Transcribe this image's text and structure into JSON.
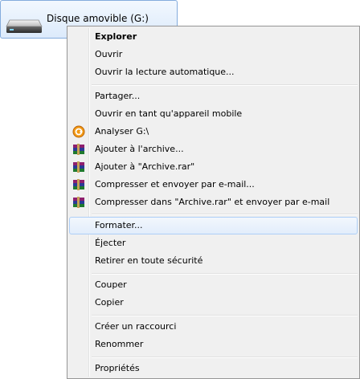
{
  "drive": {
    "label": "Disque amovible (G:)",
    "icon": "usb-drive-icon"
  },
  "menu": {
    "explorer": "Explorer",
    "ouvrir": "Ouvrir",
    "autoplay": "Ouvrir la lecture automatique...",
    "partager": "Partager...",
    "mobile": "Ouvrir en tant qu'appareil mobile",
    "analyser": "Analyser G:\\",
    "archive": "Ajouter à l'archive...",
    "archive_rar": "Ajouter à \"Archive.rar\"",
    "compress_email": "Compresser et envoyer par e-mail...",
    "compress_rar_email": "Compresser dans \"Archive.rar\" et envoyer par e-mail",
    "formater": "Formater...",
    "ejecter": "Éjecter",
    "retirer": "Retirer en toute sécurité",
    "couper": "Couper",
    "copier": "Copier",
    "raccourci": "Créer un raccourci",
    "renommer": "Renommer",
    "proprietes": "Propriétés"
  },
  "icons": {
    "antivirus": "antivirus-scan-icon",
    "winrar": "winrar-books-icon"
  },
  "colors": {
    "hover_border": "#aecff7",
    "hover_fill": "#e2edfb",
    "menu_bg": "#f0f0f0"
  }
}
